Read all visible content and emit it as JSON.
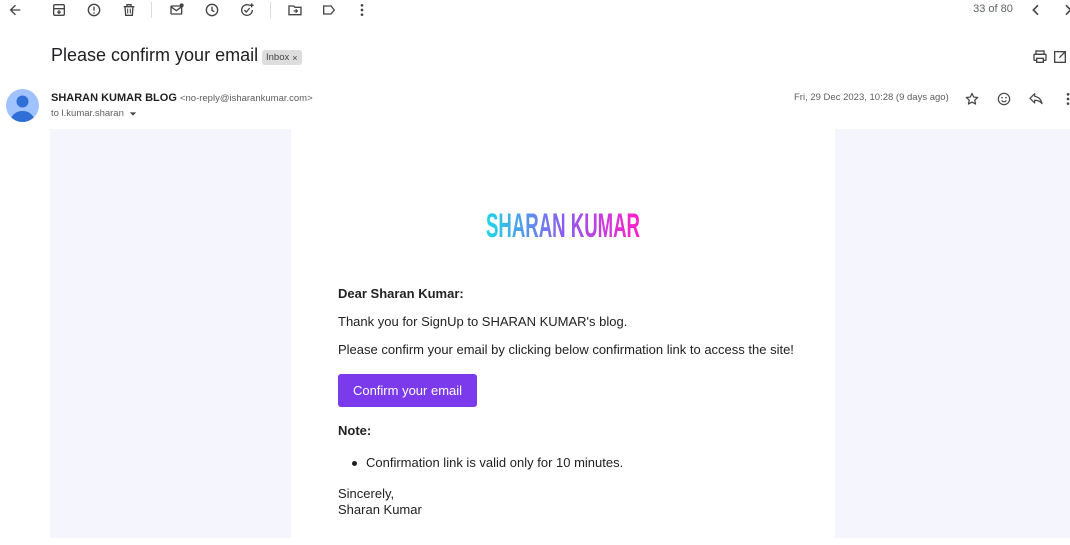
{
  "toolbar": {
    "icons": [
      "back-arrow-icon",
      "archive-icon",
      "report-spam-icon",
      "delete-icon",
      "mark-unread-icon",
      "snooze-icon",
      "add-task-icon",
      "move-to-icon",
      "label-icon",
      "more-vert-icon"
    ],
    "pager": "33 of 80"
  },
  "message": {
    "subject": "Please confirm your email",
    "label": "Inbox",
    "label_close": "×",
    "sender_name": "SHARAN KUMAR BLOG",
    "sender_email": "<no-reply@isharankumar.com>",
    "to": "to l.kumar.sharan",
    "date": "Fri, 29 Dec 2023, 10:28 (9 days ago)"
  },
  "email": {
    "logo_text": "SHARAN KUMAR",
    "logo_colors": [
      "#1ed6e6",
      "#8a5cf0",
      "#ff1fc8"
    ],
    "greeting": "Dear Sharan Kumar:",
    "para1": "Thank you for SignUp to SHARAN KUMAR's blog.",
    "para2": "Please confirm your email by clicking below confirmation link to access the site!",
    "button_label": "Confirm your email",
    "button_color": "#7c3aed",
    "note_heading": "Note:",
    "note_items": [
      "Confirmation link is valid only for 10 minutes."
    ],
    "signoff_line1": "Sincerely,",
    "signoff_line2": "Sharan Kumar"
  }
}
